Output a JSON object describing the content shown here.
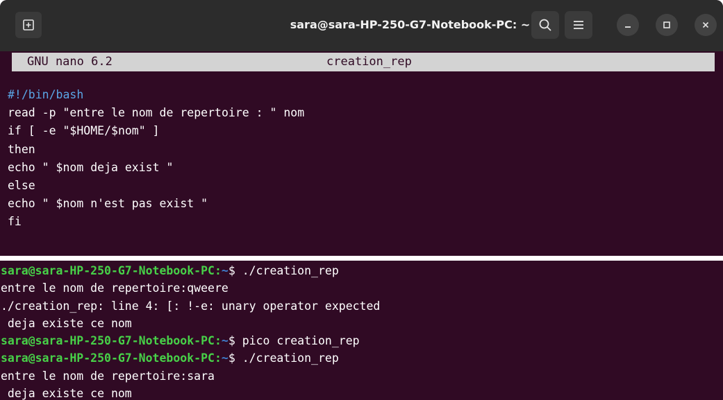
{
  "titlebar": {
    "title": "sara@sara-HP-250-G7-Notebook-PC: ~"
  },
  "nano": {
    "name": "GNU nano 6.2",
    "file": "creation_rep"
  },
  "code_lines": [
    "#!/bin/bash",
    "read -p \"entre le nom de repertoire : \" nom",
    "if [ -e \"$HOME/$nom\" ]",
    "then",
    "echo \" $nom deja exist \"",
    "else",
    "echo \" $nom n'est pas exist \"",
    "fi"
  ],
  "terminal": {
    "prompt_user": "sara@sara-HP-250-G7-Notebook-PC",
    "prompt_sep": ":",
    "prompt_path": "~",
    "prompt_dollar": "$ ",
    "lines": [
      {
        "type": "prompt",
        "cmd": "./creation_rep"
      },
      {
        "type": "out",
        "text": "entre le nom de repertoire:qweere"
      },
      {
        "type": "out",
        "text": "./creation_rep: line 4: [: !-e: unary operator expected"
      },
      {
        "type": "out",
        "text": " deja existe ce nom"
      },
      {
        "type": "prompt",
        "cmd": "pico creation_rep"
      },
      {
        "type": "prompt",
        "cmd": "./creation_rep"
      },
      {
        "type": "out",
        "text": "entre le nom de repertoire:sara"
      },
      {
        "type": "out",
        "text": " deja existe ce nom"
      }
    ]
  },
  "colors": {
    "terminal_bg": "#300a24",
    "titlebar_bg": "#2c2c2c",
    "prompt_user": "#47d148",
    "prompt_path": "#3f7fd0",
    "shebang": "#5aa6e6"
  },
  "icons": {
    "new_tab": "new-tab-icon",
    "search": "search-icon",
    "menu": "hamburger-menu-icon",
    "minimize": "minimize-icon",
    "maximize": "maximize-icon",
    "close": "close-icon"
  }
}
